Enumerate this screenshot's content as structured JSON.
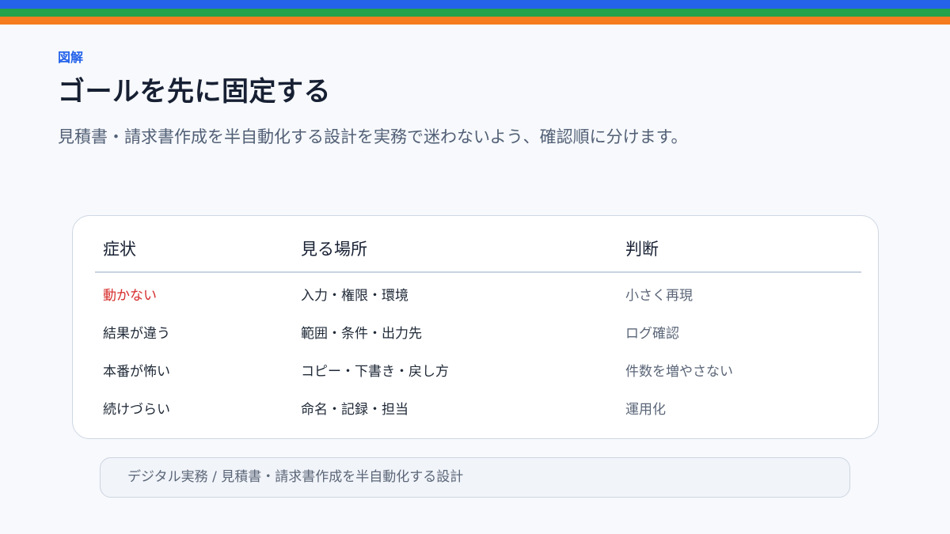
{
  "colors": {
    "stripe_blue": "#2563eb",
    "stripe_green": "#22a24a",
    "stripe_orange": "#f57c1f",
    "accent": "#2563eb",
    "alert": "#d72d2d"
  },
  "header": {
    "eyebrow": "図解",
    "title": "ゴールを先に固定する",
    "subtitle": "見積書・請求書作成を半自動化する設計を実務で迷わないよう、確認順に分けます。"
  },
  "table": {
    "columns": [
      "症状",
      "見る場所",
      "判断"
    ],
    "rows": [
      {
        "symptom": "動かない",
        "place": "入力・権限・環境",
        "judgement": "小さく再現"
      },
      {
        "symptom": "結果が違う",
        "place": "範囲・条件・出力先",
        "judgement": "ログ確認"
      },
      {
        "symptom": "本番が怖い",
        "place": "コピー・下書き・戻し方",
        "judgement": "件数を増やさない"
      },
      {
        "symptom": "続けづらい",
        "place": "命名・記録・担当",
        "judgement": "運用化"
      }
    ]
  },
  "footer": {
    "breadcrumb": "デジタル実務 / 見積書・請求書作成を半自動化する設計"
  }
}
